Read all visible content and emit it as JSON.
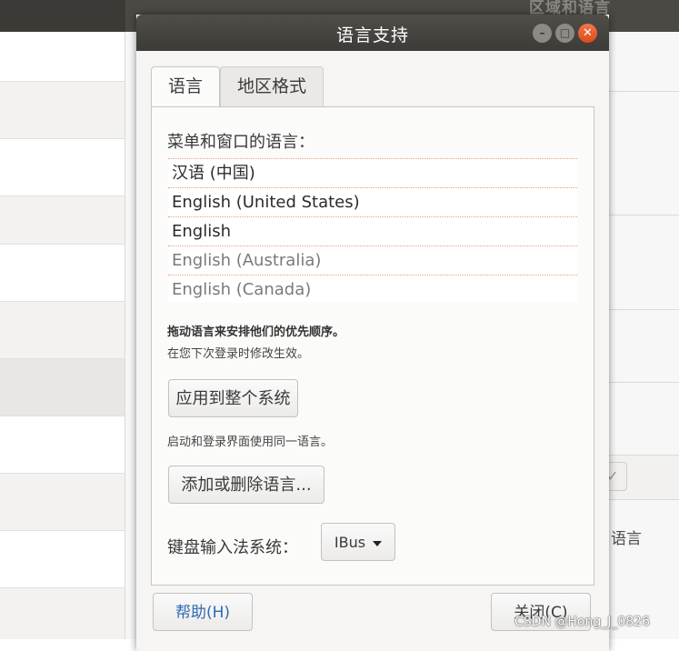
{
  "background_window": {
    "title": "区域和语言",
    "side_label": "语言"
  },
  "dialog": {
    "title": "语言支持",
    "tabs": [
      {
        "label": "语言",
        "active": true
      },
      {
        "label": "地区格式",
        "active": false
      }
    ],
    "menu_label": "菜单和窗口的语言：",
    "languages": [
      {
        "label": "汉语 (中国)",
        "style": "strong"
      },
      {
        "label": "English (United States)",
        "style": "strong"
      },
      {
        "label": "English",
        "style": "strong"
      },
      {
        "label": "English (Australia)",
        "style": "dim"
      },
      {
        "label": "English (Canada)",
        "style": "dim"
      }
    ],
    "drag_note": "拖动语言来安排他们的优先顺序。",
    "login_note": "在您下次登录时修改生效。",
    "apply_button": "应用到整个系统",
    "same_lang_note": "启动和登录界面使用同一语言。",
    "add_remove_button": "添加或删除语言...",
    "keyboard_label": "键盘输入法系统：",
    "keyboard_value": "IBus",
    "help_button": "帮助(H)",
    "close_button": "关闭(C)"
  },
  "watermark": "CSDN @Hong_J_0826",
  "colors": {
    "titlebar": "#3c3b37",
    "close_button": "#df4a16",
    "help_text": "#2f6bb1",
    "list_divider": "#e6a07c"
  }
}
